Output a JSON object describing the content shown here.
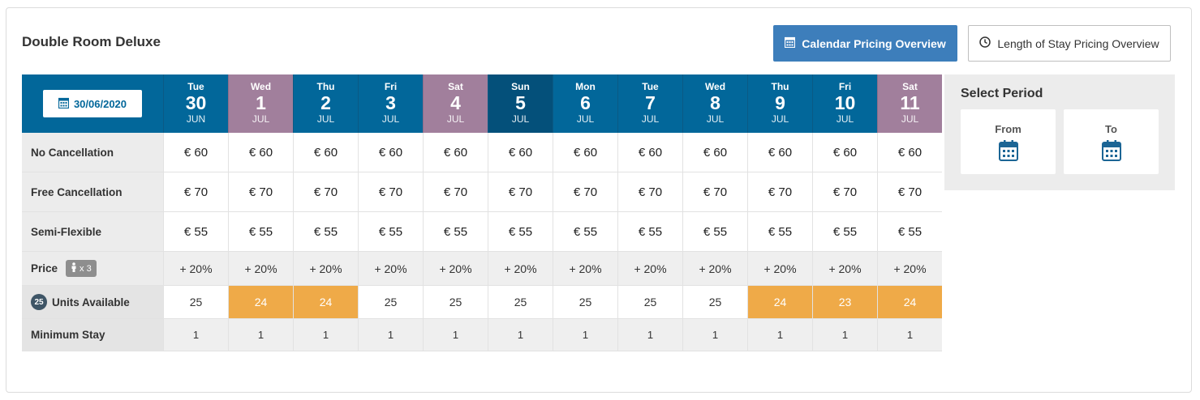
{
  "room": {
    "title": "Double Room Deluxe"
  },
  "buttons": {
    "calendar_overview": "Calendar Pricing Overview",
    "los_overview": "Length of Stay Pricing Overview"
  },
  "date_picker": {
    "value": "30/06/2020"
  },
  "days": [
    {
      "name": "Tue",
      "num": "30",
      "month": "JUN",
      "type": "weekday"
    },
    {
      "name": "Wed",
      "num": "1",
      "month": "JUL",
      "type": "weekend"
    },
    {
      "name": "Thu",
      "num": "2",
      "month": "JUL",
      "type": "weekday"
    },
    {
      "name": "Fri",
      "num": "3",
      "month": "JUL",
      "type": "weekday"
    },
    {
      "name": "Sat",
      "num": "4",
      "month": "JUL",
      "type": "weekend"
    },
    {
      "name": "Sun",
      "num": "5",
      "month": "JUL",
      "type": "today"
    },
    {
      "name": "Mon",
      "num": "6",
      "month": "JUL",
      "type": "weekday"
    },
    {
      "name": "Tue",
      "num": "7",
      "month": "JUL",
      "type": "weekday"
    },
    {
      "name": "Wed",
      "num": "8",
      "month": "JUL",
      "type": "weekday"
    },
    {
      "name": "Thu",
      "num": "9",
      "month": "JUL",
      "type": "weekday"
    },
    {
      "name": "Fri",
      "num": "10",
      "month": "JUL",
      "type": "weekday"
    },
    {
      "name": "Sat",
      "num": "11",
      "month": "JUL",
      "type": "weekend"
    }
  ],
  "rate_plans": [
    {
      "label": "No Cancellation",
      "values": [
        "€ 60",
        "€ 60",
        "€ 60",
        "€ 60",
        "€ 60",
        "€ 60",
        "€ 60",
        "€ 60",
        "€ 60",
        "€ 60",
        "€ 60",
        "€ 60"
      ]
    },
    {
      "label": "Free Cancellation",
      "values": [
        "€ 70",
        "€ 70",
        "€ 70",
        "€ 70",
        "€ 70",
        "€ 70",
        "€ 70",
        "€ 70",
        "€ 70",
        "€ 70",
        "€ 70",
        "€ 70"
      ]
    },
    {
      "label": "Semi-Flexible",
      "values": [
        "€ 55",
        "€ 55",
        "€ 55",
        "€ 55",
        "€ 55",
        "€ 55",
        "€ 55",
        "€ 55",
        "€ 55",
        "€ 55",
        "€ 55",
        "€ 55"
      ]
    }
  ],
  "price_row": {
    "label": "Price",
    "occupancy": "x 3",
    "values": [
      "+ 20%",
      "+ 20%",
      "+ 20%",
      "+ 20%",
      "+ 20%",
      "+ 20%",
      "+ 20%",
      "+ 20%",
      "+ 20%",
      "+ 20%",
      "+ 20%",
      "+ 20%"
    ]
  },
  "units_row": {
    "badge": "25",
    "label": "Units Available",
    "values": [
      "25",
      "24",
      "24",
      "25",
      "25",
      "25",
      "25",
      "25",
      "25",
      "24",
      "23",
      "24"
    ],
    "low": [
      false,
      true,
      true,
      false,
      false,
      false,
      false,
      false,
      false,
      true,
      true,
      true
    ]
  },
  "min_stay_row": {
    "label": "Minimum Stay",
    "values": [
      "1",
      "1",
      "1",
      "1",
      "1",
      "1",
      "1",
      "1",
      "1",
      "1",
      "1",
      "1"
    ]
  },
  "period": {
    "title": "Select Period",
    "from": "From",
    "to": "To"
  },
  "colors": {
    "header_blue": "#02679a",
    "weekend_mauve": "#a17f9c",
    "today_dark": "#04507a",
    "low_units_orange": "#efaa48",
    "button_blue": "#3d7ebb"
  }
}
